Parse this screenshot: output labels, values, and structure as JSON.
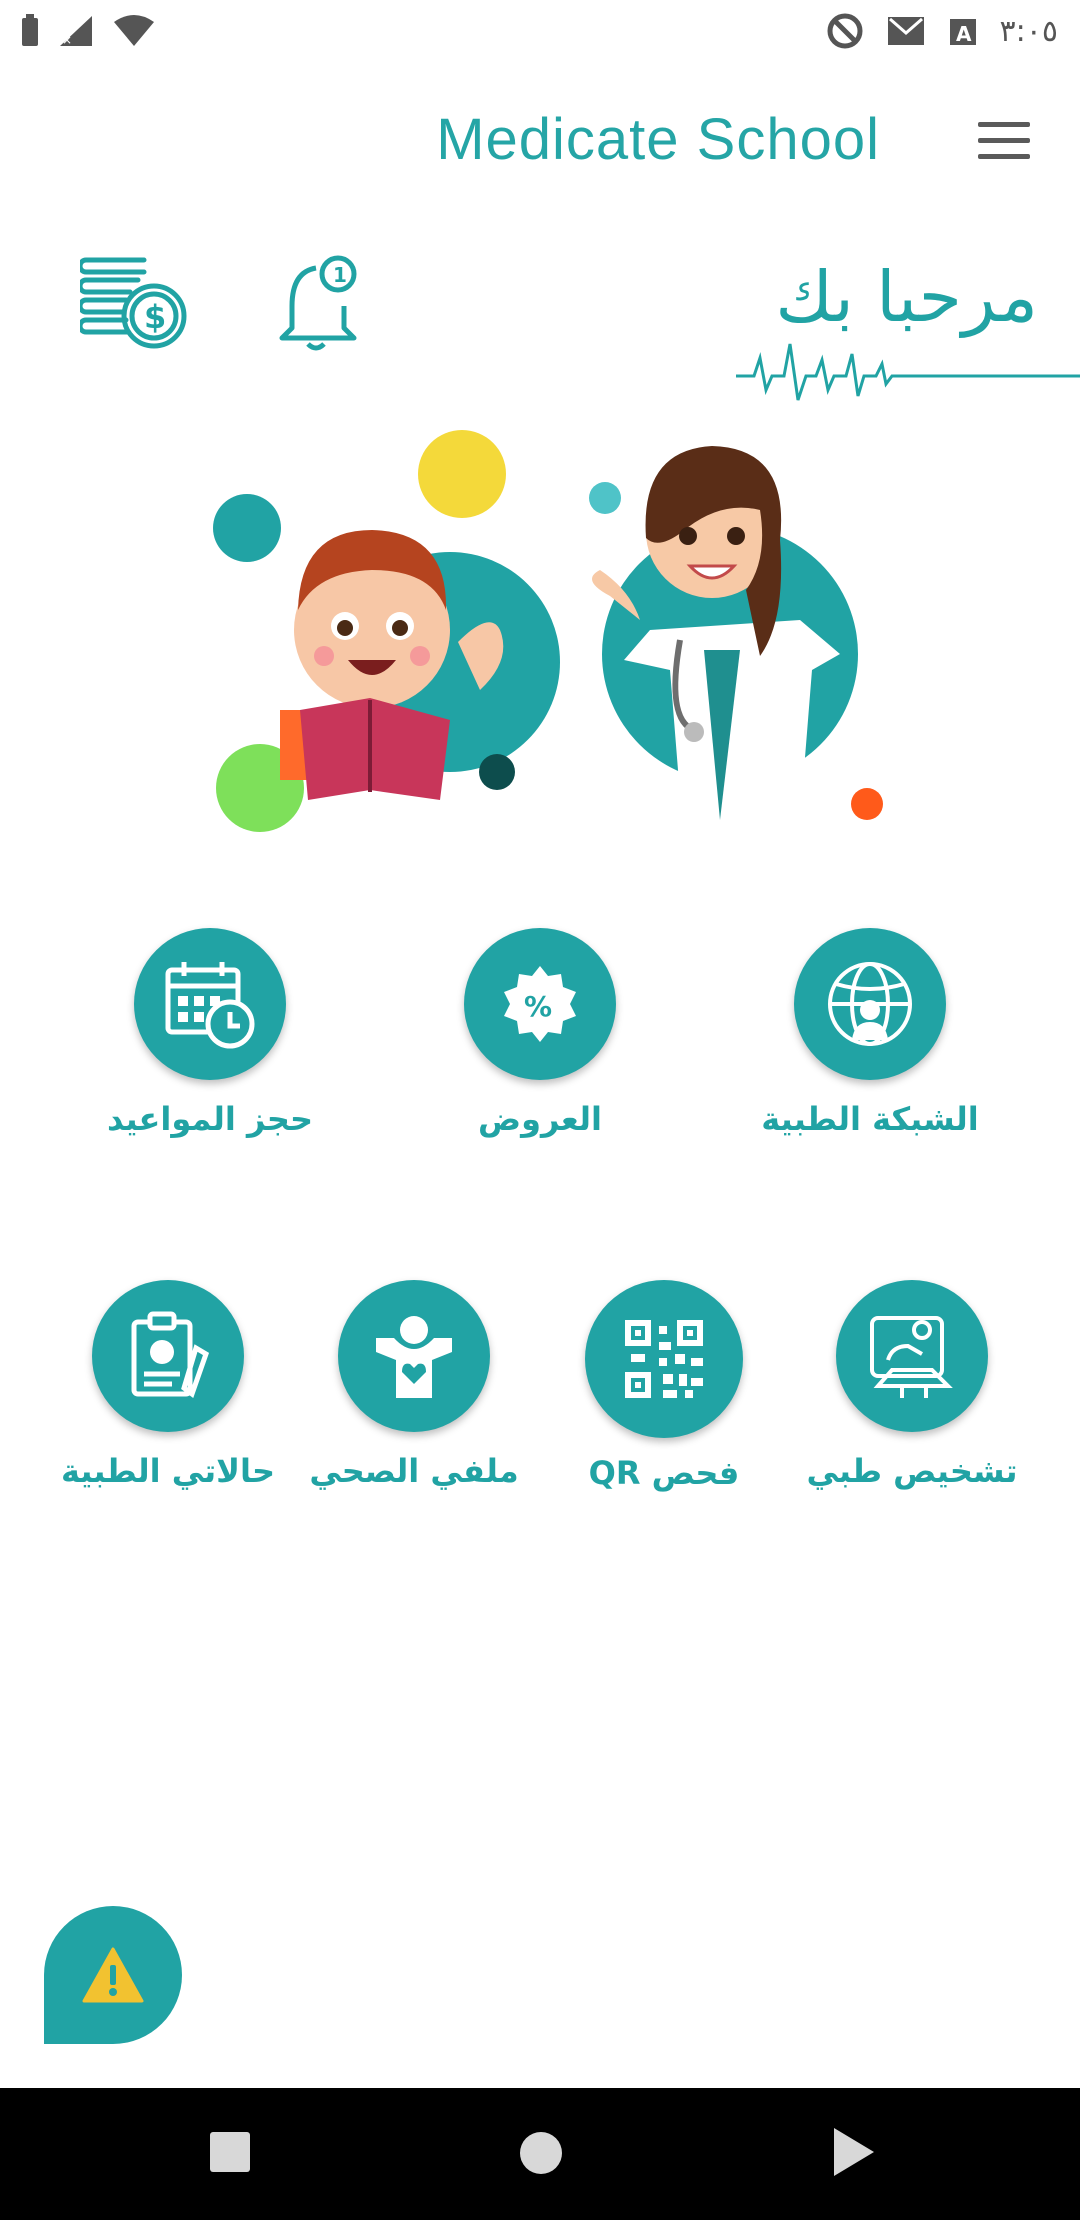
{
  "status_bar": {
    "time": "٣:٠٥",
    "icons": [
      "battery-icon",
      "signal-icon",
      "wifi-icon",
      "vpn-icon",
      "mail-icon",
      "keyboard-icon"
    ]
  },
  "header": {
    "title": "Medicate School",
    "menu_icon": "hamburger-menu-icon"
  },
  "welcome": {
    "text": "مرحبا بك",
    "icons": [
      "coins-icon",
      "bell-icon",
      "ecg-line"
    ]
  },
  "menu_row_1": [
    {
      "label": "حجز المواعيد",
      "icon": "calendar-clock-icon"
    },
    {
      "label": "العروض",
      "icon": "percent-tag-icon"
    },
    {
      "label": "الشبكة الطبية",
      "icon": "medical-network-icon"
    }
  ],
  "menu_row_2": [
    {
      "label": "حالاتي الطبية",
      "icon": "clipboard-icon"
    },
    {
      "label": "ملفي الصحي",
      "icon": "health-profile-icon"
    },
    {
      "label": "فحص QR",
      "icon": "qr-code-icon"
    },
    {
      "label": "تشخيص طبي",
      "icon": "diagnosis-icon"
    }
  ],
  "emergency_icon": "warning-icon",
  "colors": {
    "accent": "#21a3a4",
    "warning": "#f2c230"
  }
}
